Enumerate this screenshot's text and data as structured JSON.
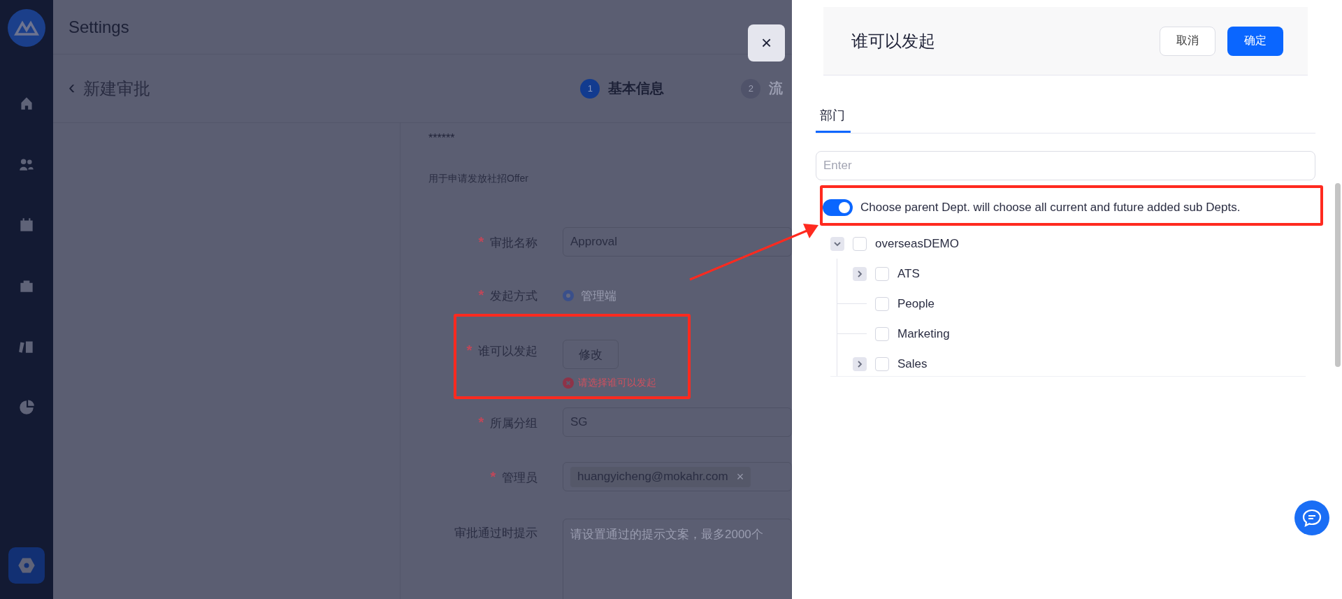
{
  "sidebar": {
    "items": [
      {
        "selected": false
      },
      {
        "selected": false
      },
      {
        "selected": false
      },
      {
        "selected": false
      },
      {
        "selected": false
      },
      {
        "selected": false
      },
      {
        "selected": true
      }
    ]
  },
  "header": {
    "title": "Settings"
  },
  "page": {
    "back": "‹",
    "title": "新建审批",
    "steps": [
      {
        "number": "1",
        "label": "基本信息",
        "selected": true
      },
      {
        "number": "2",
        "label": "流",
        "selected": false
      }
    ]
  },
  "close_button": {
    "label": "×"
  },
  "form": {
    "masked_text": "******",
    "description": "用于申请发放社招Offer",
    "fields": [
      {
        "kind": "input",
        "mark": "*",
        "label": "审批名称",
        "value": "Approval"
      },
      {
        "kind": "radio",
        "mark": "*",
        "label": "发起方式",
        "option": "管理端",
        "selected": true
      },
      {
        "kind": "button",
        "mark": "*",
        "label": "谁可以发起",
        "button": "修改",
        "error": "请选择谁可以发起"
      },
      {
        "kind": "input",
        "mark": "*",
        "label": "所属分组",
        "value": "SG"
      },
      {
        "kind": "tags",
        "mark": "*",
        "label": "管理员",
        "tags": [
          {
            "text": "huangyicheng@mokahr.com",
            "remove": "×"
          }
        ]
      },
      {
        "kind": "textarea",
        "label": "审批通过时提示",
        "placeholder": "请设置通过的提示文案，最多2000个"
      }
    ]
  },
  "drawer": {
    "title": "谁可以发起",
    "cancel": "取消",
    "confirm": "确定",
    "tabs": [
      {
        "label": "部门",
        "selected": true
      }
    ],
    "search": {
      "placeholder": "Enter"
    },
    "toggle": {
      "on": true,
      "label": "Choose parent Dept. will choose all current and future added sub Depts."
    },
    "tree": [
      {
        "kind": "branch",
        "label": "overseasDEMO",
        "checked": false,
        "expanded": true,
        "children": [
          {
            "kind": "branch",
            "label": "ATS",
            "checked": false,
            "expanded": false
          },
          {
            "kind": "leaf",
            "label": "People",
            "checked": false
          },
          {
            "kind": "leaf",
            "label": "Marketing",
            "checked": false
          },
          {
            "kind": "branch",
            "label": "Sales",
            "checked": false,
            "expanded": false
          }
        ]
      }
    ]
  }
}
